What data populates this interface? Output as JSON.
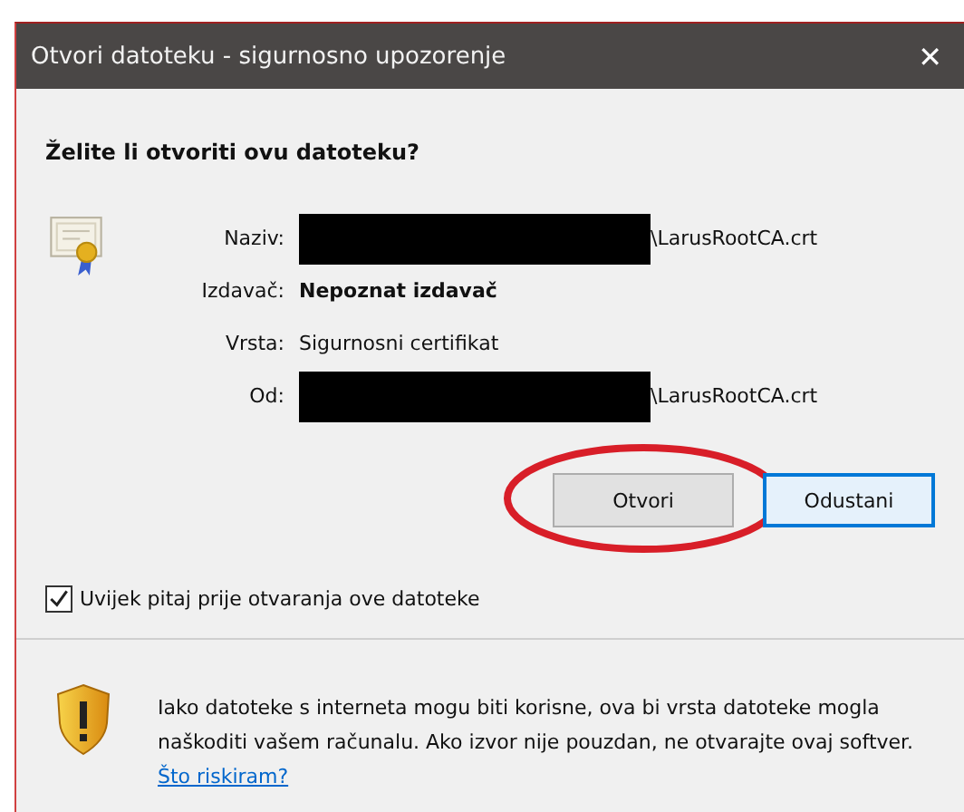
{
  "window": {
    "title": "Otvori datoteku - sigurnosno upozorenje",
    "close": "✕"
  },
  "question": "Želite li otvoriti ovu datoteku?",
  "fields": [
    {
      "label": "Naziv:",
      "value": "\\LarusRootCA.crt",
      "redacted": true,
      "bold": false
    },
    {
      "label": "Izdavač:",
      "value": "Nepoznat izdavač",
      "redacted": false,
      "bold": true
    },
    {
      "label": "Vrsta:",
      "value": "Sigurnosni certifikat",
      "redacted": false,
      "bold": false
    },
    {
      "label": "Od:",
      "value": "\\LarusRootCA.crt",
      "redacted": true,
      "bold": false
    }
  ],
  "buttons": [
    {
      "label": "Otvori",
      "default": false,
      "circled": true
    },
    {
      "label": "Odustani",
      "default": true,
      "circled": false
    }
  ],
  "checkbox": {
    "label": "Uvijek pitaj prije otvaranja ove datoteke",
    "checked": true
  },
  "warning": {
    "text": "Iako datoteke s interneta mogu biti korisne, ova bi vrsta datoteke mogla naškoditi vašem računalu. Ako izvor nije pouzdan, ne otvarajte ovaj softver.",
    "link": "Što riskiram?"
  }
}
